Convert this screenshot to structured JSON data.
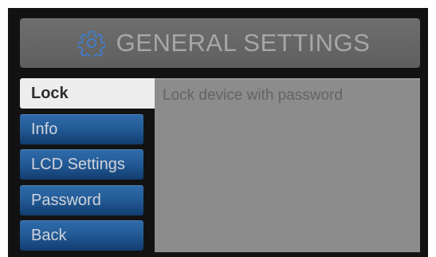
{
  "header": {
    "title": "GENERAL SETTINGS",
    "icon": "gear-icon",
    "icon_color": "#3f7ed0"
  },
  "menu": {
    "items": [
      {
        "label": "Lock",
        "active": true
      },
      {
        "label": "Info",
        "active": false
      },
      {
        "label": "LCD Settings",
        "active": false
      },
      {
        "label": "Password",
        "active": false
      },
      {
        "label": "Back",
        "active": false
      }
    ]
  },
  "panel": {
    "description": "Lock device with password"
  },
  "colors": {
    "menu_blue": "#245c98",
    "active_tab": "#ededed",
    "panel_bg": "#8c8c8c",
    "header_bg": "#666666",
    "frame_bg": "#121212"
  }
}
